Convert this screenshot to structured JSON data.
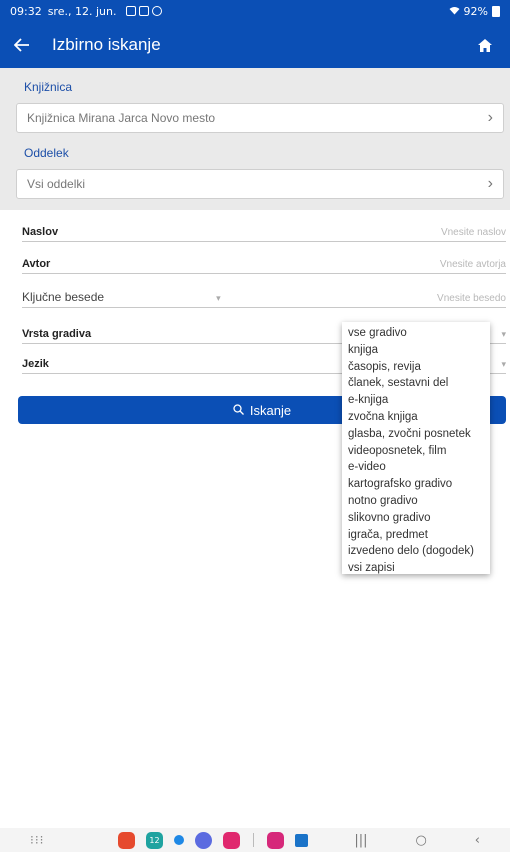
{
  "status_bar": {
    "time": "09:32",
    "date": "sre., 12. jun.",
    "battery": "92%"
  },
  "app_bar": {
    "title": "Izbirno iskanje"
  },
  "library": {
    "label": "Knjižnica",
    "value": "Knjižnica Mirana Jarca Novo mesto"
  },
  "department": {
    "label": "Oddelek",
    "value": "Vsi oddelki"
  },
  "form": {
    "title": {
      "label": "Naslov",
      "placeholder": "Vnesite naslov"
    },
    "author": {
      "label": "Avtor",
      "placeholder": "Vnesite avtorja"
    },
    "keywords": {
      "label": "Ključne besede",
      "placeholder": "Vnesite besedo"
    },
    "material_type": {
      "label": "Vrsta gradiva"
    },
    "language": {
      "label": "Jezik"
    }
  },
  "search_button": {
    "label": "Iskanje"
  },
  "dropdown_options": [
    "vse gradivo",
    "knjiga",
    "časopis, revija",
    "članek, sestavni del",
    "e-knjiga",
    "zvočna knjiga",
    "glasba, zvočni posnetek",
    "videoposnetek, film",
    "e-video",
    "kartografsko gradivo",
    "notno gradivo",
    "slikovno gradivo",
    "igrača, predmet",
    "izvedeno delo (dogodek)",
    "vsi zapisi"
  ],
  "nav_bar": {
    "calendar_day": "12",
    "apps": [
      {
        "name": "keep-icon",
        "color": "#e64a2e"
      },
      {
        "name": "calendar-icon",
        "color": "#1fa3a0"
      },
      {
        "name": "chat-icon",
        "color": "#1e88e5"
      },
      {
        "name": "messages-icon",
        "color": "#5b6be0"
      },
      {
        "name": "screen-recorder-icon",
        "color": "#e0286e"
      },
      {
        "name": "bixby-icon",
        "color": "#d6287a"
      },
      {
        "name": "outlook-icon",
        "color": "#1a73c8"
      }
    ]
  },
  "colors": {
    "primary": "#0b4fb5",
    "accent_label": "#1d4fa8",
    "panel_bg": "#eaeaea"
  }
}
